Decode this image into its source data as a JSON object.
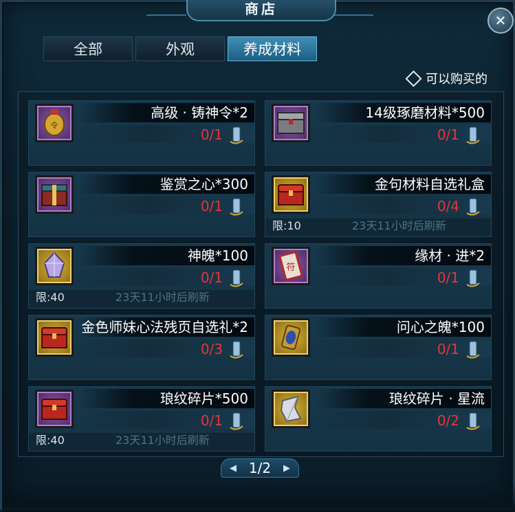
{
  "window": {
    "title": "商店",
    "close_symbol": "✕"
  },
  "tabs": [
    {
      "label": "全部",
      "active": false
    },
    {
      "label": "外观",
      "active": false
    },
    {
      "label": "养成材料",
      "active": true
    }
  ],
  "filter": {
    "label": "可以购买的",
    "checked": false
  },
  "items": [
    {
      "name": "高级 · 铸神令*2",
      "count": "0/1",
      "icon": "token-icon",
      "frame": "purple"
    },
    {
      "name": "14级琢磨材料*500",
      "count": "0/1",
      "icon": "chest-icon",
      "frame": "purple"
    },
    {
      "name": "鉴赏之心*300",
      "count": "0/1",
      "icon": "gift-box-icon",
      "frame": "purple"
    },
    {
      "name": "金句材料自选礼盒",
      "count": "0/4",
      "icon": "red-chest-icon",
      "frame": "gold",
      "limit": "限:10",
      "refresh": "23天11小时后刷新"
    },
    {
      "name": "神魄*100",
      "count": "0/1",
      "icon": "crystal-icon",
      "frame": "gold",
      "limit": "限:40",
      "refresh": "23天11小时后刷新"
    },
    {
      "name": "缘材 · 进*2",
      "count": "0/1",
      "icon": "talisman-icon",
      "frame": "purple"
    },
    {
      "name": "金色师妹心法残页自选礼*2",
      "count": "0/3",
      "icon": "red-chest-icon",
      "frame": "gold"
    },
    {
      "name": "问心之魄*100",
      "count": "0/1",
      "icon": "amulet-icon",
      "frame": "gold"
    },
    {
      "name": "琅纹碎片*500",
      "count": "0/1",
      "icon": "red-chest-icon",
      "frame": "purple",
      "limit": "限:40",
      "refresh": "23天11小时后刷新"
    },
    {
      "name": "琅纹碎片 · 星流",
      "count": "0/2",
      "icon": "shard-icon",
      "frame": "gold"
    }
  ],
  "pager": {
    "text": "1/2"
  },
  "colors": {
    "count": "#e13838",
    "active_tab": "#2f7ea6",
    "refresh": "#4d7488"
  }
}
